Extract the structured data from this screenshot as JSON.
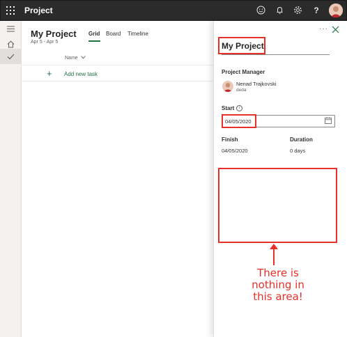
{
  "topbar": {
    "app_title": "Project",
    "icons": [
      "waffle-icon",
      "smiley-icon",
      "bell-icon",
      "gear-icon",
      "help-icon"
    ],
    "help_label": "?"
  },
  "rail": {
    "items": [
      "hamburger-icon",
      "home-icon",
      "checkmark-icon"
    ]
  },
  "main": {
    "project_title": "My Project",
    "project_dates": "Apr 5 - Apr 5",
    "tabs": [
      {
        "label": "Grid",
        "active": true
      },
      {
        "label": "Board",
        "active": false
      },
      {
        "label": "Timeline",
        "active": false
      }
    ],
    "column_header": "Name",
    "add_task_label": "Add new task",
    "accent_color": "#217346"
  },
  "details": {
    "more_label": "···",
    "title": "My Project",
    "manager_label": "Project Manager",
    "manager_name": "Nenad Trajkovski",
    "manager_sub": "deda",
    "start_label": "Start",
    "start_value": "04/05/2020",
    "finish_label": "Finish",
    "finish_value": "04/05/2020",
    "duration_label": "Duration",
    "duration_value": "0 days"
  },
  "annotation": {
    "callout_lines": [
      "There is",
      "nothing in",
      "this area!"
    ],
    "color": "#e8302b"
  }
}
